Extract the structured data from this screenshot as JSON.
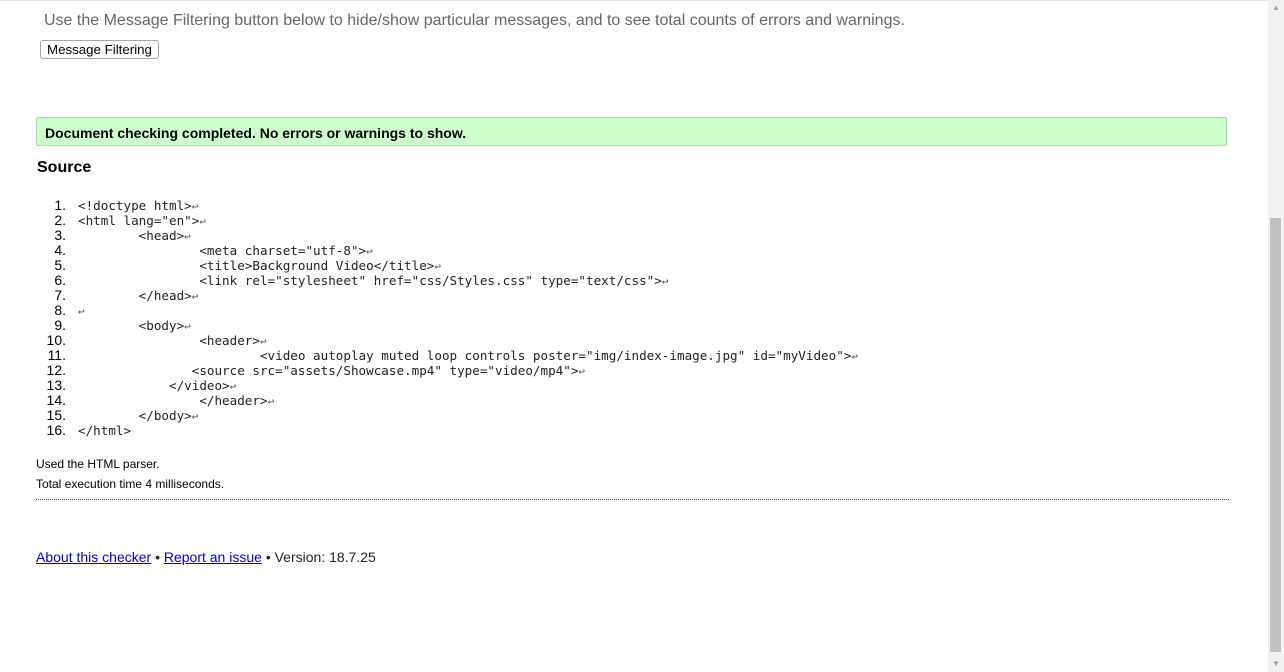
{
  "intro_text": "Use the Message Filtering button below to hide/show particular messages, and to see total counts of errors and warnings.",
  "filter_button_label": "Message Filtering",
  "result_message": "Document checking completed. No errors or warnings to show.",
  "source_heading": "Source",
  "eol_symbol": "↩",
  "source_lines": [
    {
      "num": "1.",
      "text": "<!doctype html>",
      "eol": true
    },
    {
      "num": "2.",
      "text": "<html lang=\"en\">",
      "eol": true
    },
    {
      "num": "3.",
      "text": "        <head>",
      "eol": true
    },
    {
      "num": "4.",
      "text": "                <meta charset=\"utf-8\">",
      "eol": true
    },
    {
      "num": "5.",
      "text": "                <title>Background Video</title>",
      "eol": true
    },
    {
      "num": "6.",
      "text": "                <link rel=\"stylesheet\" href=\"css/Styles.css\" type=\"text/css\">",
      "eol": true
    },
    {
      "num": "7.",
      "text": "        </head>",
      "eol": true
    },
    {
      "num": "8.",
      "text": "",
      "eol": true
    },
    {
      "num": "9.",
      "text": "        <body>",
      "eol": true
    },
    {
      "num": "10.",
      "text": "                <header>",
      "eol": true
    },
    {
      "num": "11.",
      "text": "                        <video autoplay muted loop controls poster=\"img/index-image.jpg\" id=\"myVideo\">",
      "eol": true
    },
    {
      "num": "12.",
      "text": "               <source src=\"assets/Showcase.mp4\" type=\"video/mp4\">",
      "eol": true
    },
    {
      "num": "13.",
      "text": "            </video>",
      "eol": true
    },
    {
      "num": "14.",
      "text": "                </header>",
      "eol": true
    },
    {
      "num": "15.",
      "text": "        </body>",
      "eol": true
    },
    {
      "num": "16.",
      "text": "</html>",
      "eol": false
    }
  ],
  "parser_text": "Used the HTML parser.",
  "execution_time_text": "Total execution time 4 milliseconds.",
  "footer": {
    "about_link": "About this checker",
    "separator": "•",
    "report_link": "Report an issue",
    "version_text": "Version: 18.7.25"
  }
}
